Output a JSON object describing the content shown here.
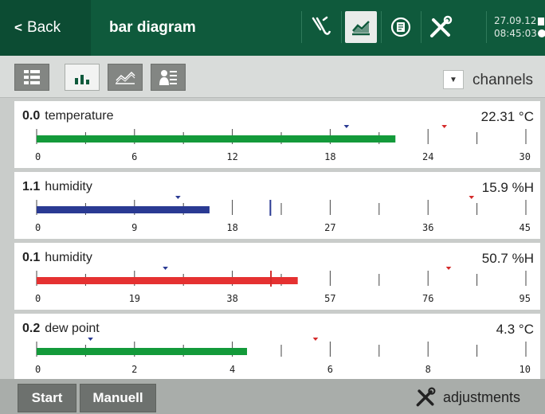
{
  "header": {
    "back_label": "Back",
    "title": "bar diagram",
    "date": "27.09.12",
    "time": "08:45:03",
    "icons": [
      "wiring-icon",
      "chart-icon",
      "record-icon",
      "tools-icon"
    ]
  },
  "toolbar": {
    "views": [
      "list-view-icon",
      "bar-view-icon",
      "line-view-icon",
      "contact-view-icon"
    ],
    "channels_label": "channels"
  },
  "channels": [
    {
      "id": "0.0",
      "name": "temperature",
      "value": "22.31 °C",
      "bar_value": 22.0,
      "bar_color": "#139a3a",
      "min": 0,
      "max": 30,
      "ticks": [
        "0",
        "6",
        "12",
        "18",
        "24",
        "30"
      ],
      "marker_blue": 19.0,
      "marker_red": 25.0,
      "marker_blue_line": null,
      "marker_red_line": null
    },
    {
      "id": "1.1",
      "name": "humidity",
      "value": "15.9 %H",
      "bar_value": 15.9,
      "bar_color": "#2a3a93",
      "min": 0,
      "max": 45,
      "ticks": [
        "0",
        "9",
        "18",
        "27",
        "36",
        "45"
      ],
      "marker_blue": 13.0,
      "marker_red": 40.0,
      "marker_blue_line": 21.5,
      "marker_red_line": null
    },
    {
      "id": "0.1",
      "name": "humidity",
      "value": "50.7 %H",
      "bar_value": 50.7,
      "bar_color": "#e53131",
      "min": 0,
      "max": 95,
      "ticks": [
        "0",
        "19",
        "38",
        "57",
        "76",
        "95"
      ],
      "marker_blue": 25.0,
      "marker_red": 80.0,
      "marker_blue_line": null,
      "marker_red_line": 45.5
    },
    {
      "id": "0.2",
      "name": "dew point",
      "value": "4.3 °C",
      "bar_value": 4.3,
      "bar_color": "#139a3a",
      "min": 0,
      "max": 10,
      "ticks": [
        "0",
        "2",
        "4",
        "6",
        "8",
        "10"
      ],
      "marker_blue": 1.1,
      "marker_red": 5.7,
      "marker_blue_line": null,
      "marker_red_line": null
    }
  ],
  "footer": {
    "start_label": "Start",
    "manual_label": "Manuell",
    "adjustments_label": "adjustments"
  }
}
